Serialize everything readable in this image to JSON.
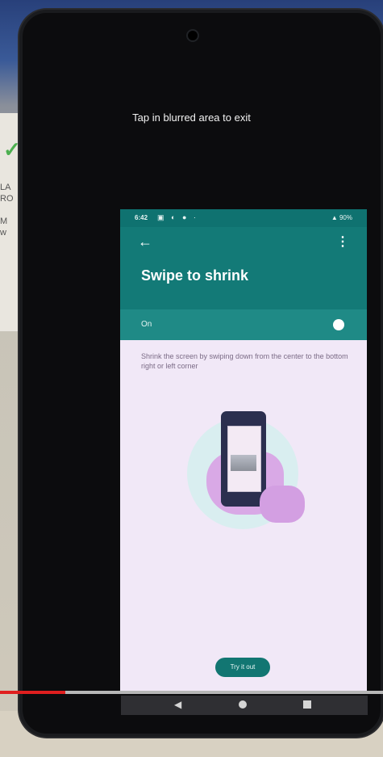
{
  "overlay": {
    "hint": "Tap in blurred area to exit"
  },
  "status_bar": {
    "time": "6:42",
    "icons": "▣ ◐ ● ·",
    "battery": "▲ 90%"
  },
  "app_bar": {
    "title": "Swipe to shrink"
  },
  "toggle": {
    "label": "On",
    "state": "on"
  },
  "description": "Shrink the screen by swiping down from the center to the bottom right or left corner",
  "buttons": {
    "try_it": "Try it out"
  },
  "video": {
    "progress": 0.17
  },
  "colors": {
    "accent": "#137a77",
    "accent_dark": "#0f7270",
    "screen_bg": "#f1e8f7",
    "progress": "#e01f1f"
  },
  "icons": {
    "back": "arrow-left",
    "more": "more-vert",
    "nav_back": "triangle-left",
    "nav_home": "circle",
    "nav_recents": "square"
  }
}
